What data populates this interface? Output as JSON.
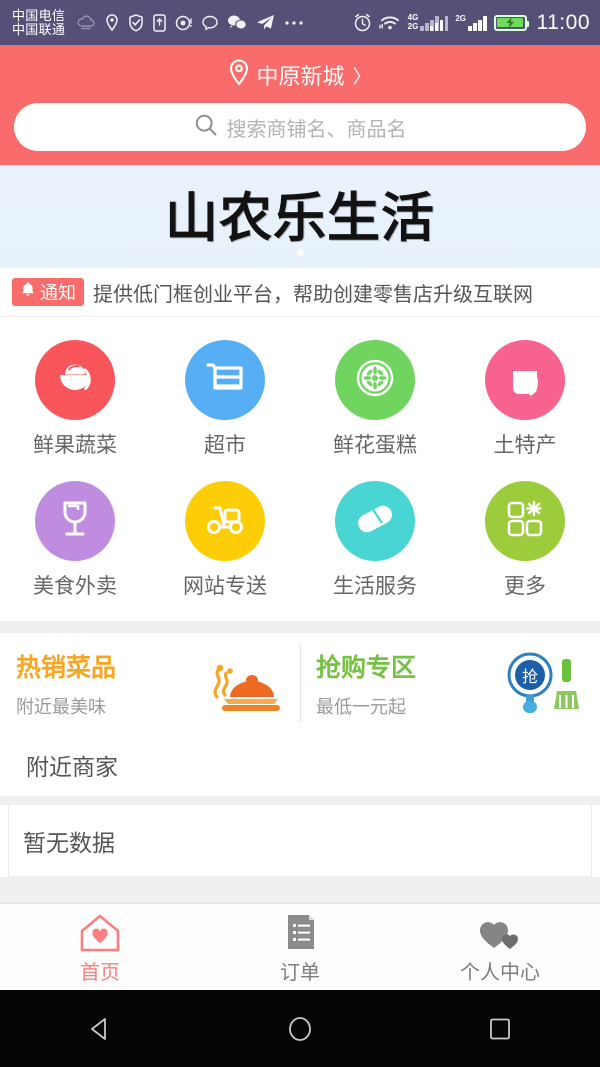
{
  "statusbar": {
    "carrier_line1": "中国电信",
    "carrier_line2": "中国联通",
    "net_primary_top": "4G",
    "net_primary_bottom": "2G",
    "net_secondary": "2G",
    "clock": "11:00",
    "icons": [
      "weather-cloud-icon",
      "location-pin-icon",
      "shield-check-icon",
      "sdcard-icon",
      "screen-record-icon",
      "message-bubble-icon",
      "wechat-icon",
      "telegram-send-icon",
      "more-dots-icon",
      "alarm-clock-icon",
      "wifi-icon"
    ]
  },
  "header": {
    "location": "中原新城",
    "location_chevron": "〉",
    "search_placeholder": "搜索商铺名、商品名"
  },
  "banner": {
    "logo_text": "山农乐生活",
    "dot_count": 1
  },
  "notice": {
    "badge_label": "通知",
    "text": "提供低门框创业平台，帮助创建零售店升级互联网"
  },
  "categories": [
    {
      "label": "鲜果蔬菜",
      "color": "#f8565a",
      "icon": "fruit-bowl-icon"
    },
    {
      "label": "超市",
      "color": "#56aef4",
      "icon": "shopping-cart-icon"
    },
    {
      "label": "鲜花蛋糕",
      "color": "#6fd55f",
      "icon": "flower-bloom-icon"
    },
    {
      "label": "土特产",
      "color": "#f8628f",
      "icon": "gift-bag-icon"
    },
    {
      "label": "美食外卖",
      "color": "#bf8ce0",
      "icon": "wine-glass-icon"
    },
    {
      "label": "网站专送",
      "color": "#fdcd08",
      "icon": "delivery-scooter-icon"
    },
    {
      "label": "生活服务",
      "color": "#4ad5d5",
      "icon": "capsule-pill-icon"
    },
    {
      "label": "更多",
      "color": "#9ccb3b",
      "icon": "grid-more-icon"
    }
  ],
  "promos": [
    {
      "title": "热销菜品",
      "subtitle": "附近最美味",
      "title_color": "#f5a623",
      "art": "food-cloche-icon"
    },
    {
      "title": "抢购专区",
      "subtitle": "最低一元起",
      "title_color": "#76c043",
      "art": "magnifier-grab-icon",
      "art_char": "抢"
    }
  ],
  "nearby": {
    "section_title": "附近商家",
    "empty_text": "暂无数据"
  },
  "tabbar": [
    {
      "label": "首页",
      "icon": "home-heart-icon",
      "active": true,
      "color": "#f98080"
    },
    {
      "label": "订单",
      "icon": "order-list-icon",
      "active": false,
      "color": "#808080"
    },
    {
      "label": "个人中心",
      "icon": "hearts-user-icon",
      "active": false,
      "color": "#808080"
    }
  ],
  "navbar": [
    {
      "label": "back-triangle-icon"
    },
    {
      "label": "home-circle-icon"
    },
    {
      "label": "recents-square-icon"
    }
  ]
}
